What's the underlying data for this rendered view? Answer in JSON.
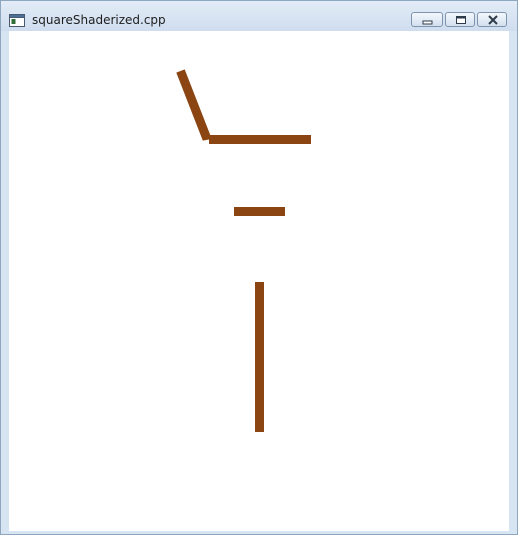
{
  "window": {
    "title": "squareShaderized.cpp",
    "icon": "application-window-icon",
    "controls": {
      "minimize_icon": "minimize-icon",
      "restore_icon": "restore-icon",
      "close_icon": "close-icon"
    }
  },
  "canvas": {
    "background_color": "#ffffff",
    "stroke_color": "#8b4513"
  }
}
